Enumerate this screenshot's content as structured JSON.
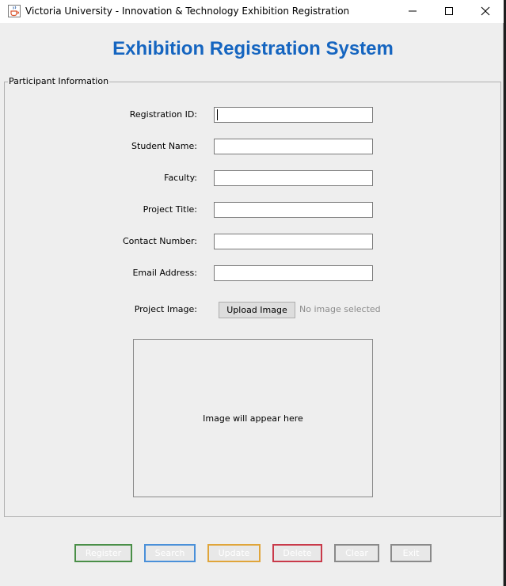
{
  "window": {
    "title": "Victoria University - Innovation & Technology Exhibition Registration",
    "icon": "java-cup-icon"
  },
  "header": {
    "heading": "Exhibition Registration System",
    "heading_color": "#1565c0"
  },
  "panel": {
    "legend": "Participant Information"
  },
  "fields": [
    {
      "label": "Registration ID:",
      "value": "",
      "focused": true
    },
    {
      "label": "Student Name:",
      "value": ""
    },
    {
      "label": "Faculty:",
      "value": ""
    },
    {
      "label": "Project Title:",
      "value": ""
    },
    {
      "label": "Contact Number:",
      "value": ""
    },
    {
      "label": "Email Address:",
      "value": ""
    }
  ],
  "image_section": {
    "label": "Project Image:",
    "upload_button": "Upload Image",
    "status": "No image selected",
    "placeholder": "Image will appear here"
  },
  "actions": {
    "register": "Register",
    "search": "Search",
    "update": "Update",
    "delete": "Delete",
    "clear": "Clear",
    "exit": "Exit"
  },
  "colors": {
    "register": "#4a8f48",
    "search": "#4a90d9",
    "update": "#e0a53a",
    "delete": "#c93a4a",
    "neutral": "#8a8a8a"
  }
}
